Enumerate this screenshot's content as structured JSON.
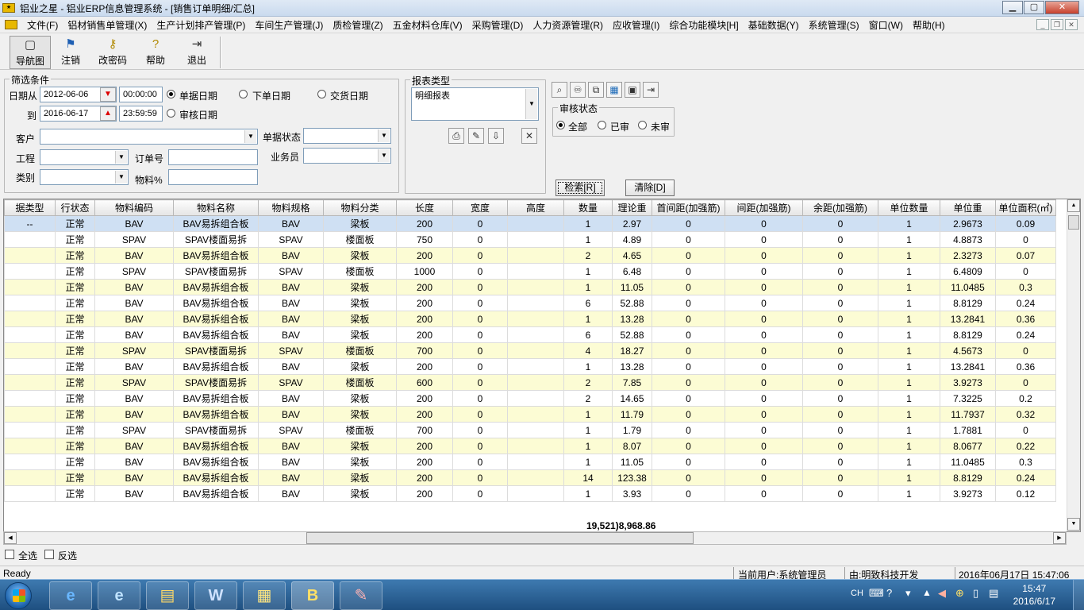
{
  "window": {
    "title": "铝业之星 - 铝业ERP信息管理系统 - [销售订单明细/汇总]",
    "minimize": "▁",
    "maximize": "▢",
    "close": "✕"
  },
  "menu": [
    "文件(F)",
    "铝材销售单管理(X)",
    "生产计划排产管理(P)",
    "车间生产管理(J)",
    "质检管理(Z)",
    "五金材料仓库(V)",
    "采购管理(D)",
    "人力资源管理(R)",
    "应收管理(I)",
    "综合功能模块[H]",
    "基础数据(Y)",
    "系统管理(S)",
    "窗口(W)",
    "帮助(H)"
  ],
  "toolbar": {
    "nav": "导航图",
    "logout": "注销",
    "password": "改密码",
    "help": "帮助",
    "exit": "退出"
  },
  "filter": {
    "legend": "筛选条件",
    "date_from_label": "日期从",
    "date_from": "2012-06-06",
    "time_from": "00:00:00",
    "date_to_label": "到",
    "date_to": "2016-06-17",
    "time_to": "23:59:59",
    "radio_doc_date": "单据日期",
    "radio_order_date": "下单日期",
    "radio_delivery_date": "交货日期",
    "radio_audit_date": "审核日期",
    "customer_label": "客户",
    "doc_status_label": "单据状态",
    "project_label": "工程",
    "order_no_label": "订单号",
    "salesman_label": "业务员",
    "category_label": "类别",
    "material_pct_label": "物料%"
  },
  "report": {
    "legend": "报表类型",
    "selected": "明细报表"
  },
  "audit": {
    "legend": "审核状态",
    "all": "全部",
    "audited": "已审",
    "unaudited": "未审"
  },
  "buttons": {
    "search": "检索[R]",
    "clear": "清除[D]"
  },
  "table": {
    "headers": [
      "据类型",
      "行状态",
      "物料编码",
      "物料名称",
      "物料规格",
      "物料分类",
      "长度",
      "宽度",
      "高度",
      "数量",
      "理论重",
      "首间距(加强筋)",
      "间距(加强筋)",
      "余距(加强筋)",
      "单位数量",
      "单位重",
      "单位面积(㎡)"
    ],
    "rows": [
      [
        "--",
        "正常",
        "BAV",
        "BAV易拆组合板",
        "BAV",
        "梁板",
        "200",
        "0",
        "",
        "1",
        "2.97",
        "0",
        "0",
        "0",
        "1",
        "2.9673",
        "0.09"
      ],
      [
        "",
        "正常",
        "SPAV",
        "SPAV楼面易拆",
        "SPAV",
        "楼面板",
        "750",
        "0",
        "",
        "1",
        "4.89",
        "0",
        "0",
        "0",
        "1",
        "4.8873",
        "0"
      ],
      [
        "",
        "正常",
        "BAV",
        "BAV易拆组合板",
        "BAV",
        "梁板",
        "200",
        "0",
        "",
        "2",
        "4.65",
        "0",
        "0",
        "0",
        "1",
        "2.3273",
        "0.07"
      ],
      [
        "",
        "正常",
        "SPAV",
        "SPAV楼面易拆",
        "SPAV",
        "楼面板",
        "1000",
        "0",
        "",
        "1",
        "6.48",
        "0",
        "0",
        "0",
        "1",
        "6.4809",
        "0"
      ],
      [
        "",
        "正常",
        "BAV",
        "BAV易拆组合板",
        "BAV",
        "梁板",
        "200",
        "0",
        "",
        "1",
        "11.05",
        "0",
        "0",
        "0",
        "1",
        "11.0485",
        "0.3"
      ],
      [
        "",
        "正常",
        "BAV",
        "BAV易拆组合板",
        "BAV",
        "梁板",
        "200",
        "0",
        "",
        "6",
        "52.88",
        "0",
        "0",
        "0",
        "1",
        "8.8129",
        "0.24"
      ],
      [
        "",
        "正常",
        "BAV",
        "BAV易拆组合板",
        "BAV",
        "梁板",
        "200",
        "0",
        "",
        "1",
        "13.28",
        "0",
        "0",
        "0",
        "1",
        "13.2841",
        "0.36"
      ],
      [
        "",
        "正常",
        "BAV",
        "BAV易拆组合板",
        "BAV",
        "梁板",
        "200",
        "0",
        "",
        "6",
        "52.88",
        "0",
        "0",
        "0",
        "1",
        "8.8129",
        "0.24"
      ],
      [
        "",
        "正常",
        "SPAV",
        "SPAV楼面易拆",
        "SPAV",
        "楼面板",
        "700",
        "0",
        "",
        "4",
        "18.27",
        "0",
        "0",
        "0",
        "1",
        "4.5673",
        "0"
      ],
      [
        "",
        "正常",
        "BAV",
        "BAV易拆组合板",
        "BAV",
        "梁板",
        "200",
        "0",
        "",
        "1",
        "13.28",
        "0",
        "0",
        "0",
        "1",
        "13.2841",
        "0.36"
      ],
      [
        "",
        "正常",
        "SPAV",
        "SPAV楼面易拆",
        "SPAV",
        "楼面板",
        "600",
        "0",
        "",
        "2",
        "7.85",
        "0",
        "0",
        "0",
        "1",
        "3.9273",
        "0"
      ],
      [
        "",
        "正常",
        "BAV",
        "BAV易拆组合板",
        "BAV",
        "梁板",
        "200",
        "0",
        "",
        "2",
        "14.65",
        "0",
        "0",
        "0",
        "1",
        "7.3225",
        "0.2"
      ],
      [
        "",
        "正常",
        "BAV",
        "BAV易拆组合板",
        "BAV",
        "梁板",
        "200",
        "0",
        "",
        "1",
        "11.79",
        "0",
        "0",
        "0",
        "1",
        "11.7937",
        "0.32"
      ],
      [
        "",
        "正常",
        "SPAV",
        "SPAV楼面易拆",
        "SPAV",
        "楼面板",
        "700",
        "0",
        "",
        "1",
        "1.79",
        "0",
        "0",
        "0",
        "1",
        "1.7881",
        "0"
      ],
      [
        "",
        "正常",
        "BAV",
        "BAV易拆组合板",
        "BAV",
        "梁板",
        "200",
        "0",
        "",
        "1",
        "8.07",
        "0",
        "0",
        "0",
        "1",
        "8.0677",
        "0.22"
      ],
      [
        "",
        "正常",
        "BAV",
        "BAV易拆组合板",
        "BAV",
        "梁板",
        "200",
        "0",
        "",
        "1",
        "11.05",
        "0",
        "0",
        "0",
        "1",
        "11.0485",
        "0.3"
      ],
      [
        "",
        "正常",
        "BAV",
        "BAV易拆组合板",
        "BAV",
        "梁板",
        "200",
        "0",
        "",
        "14",
        "123.38",
        "0",
        "0",
        "0",
        "1",
        "8.8129",
        "0.24"
      ],
      [
        "",
        "正常",
        "BAV",
        "BAV易拆组合板",
        "BAV",
        "梁板",
        "200",
        "0",
        "",
        "1",
        "3.93",
        "0",
        "0",
        "0",
        "1",
        "3.9273",
        "0.12"
      ]
    ],
    "totals": "19,521)8,968.86"
  },
  "bottom": {
    "select_all": "全选",
    "invert": "反选"
  },
  "status": {
    "ready": "Ready",
    "user": "当前用户:系统管理员",
    "developer": "由:明致科技开发",
    "datetime": "2016年06月17日 15:47:06"
  },
  "taskbar": {
    "ime": "CH",
    "time": "15:47",
    "date": "2016/6/17",
    "apps": [
      "e",
      "e",
      "▤",
      "W",
      "▦",
      "B",
      "✎"
    ]
  }
}
